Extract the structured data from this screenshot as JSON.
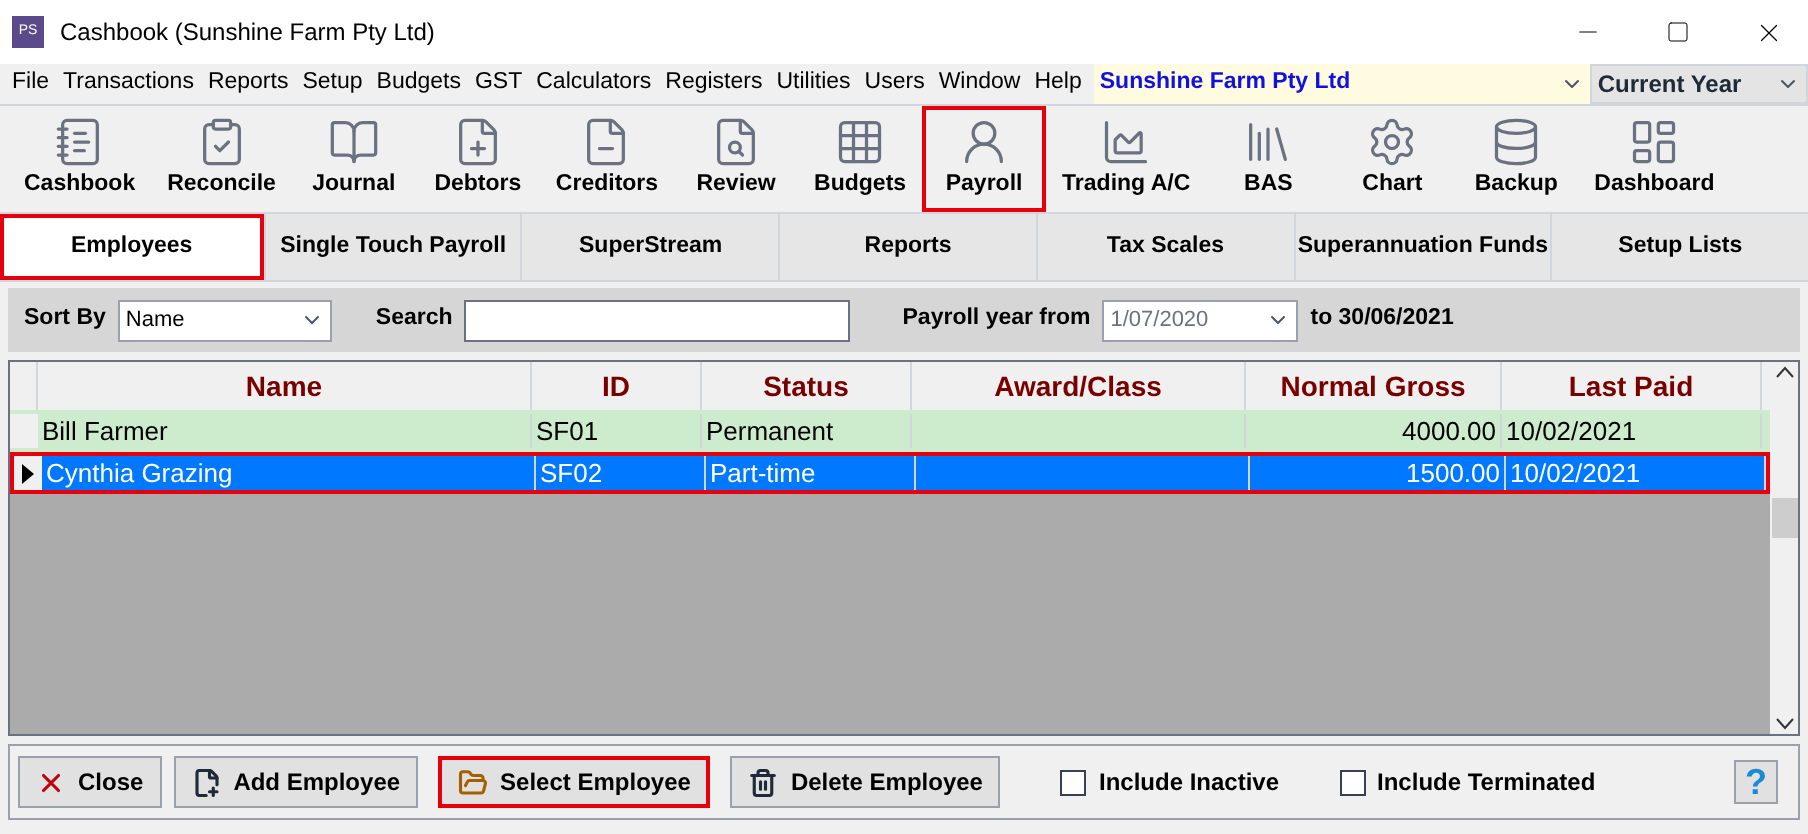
{
  "window": {
    "title": "Cashbook (Sunshine Farm Pty Ltd)",
    "app_icon": "PS"
  },
  "menu": [
    "File",
    "Transactions",
    "Reports",
    "Setup",
    "Budgets",
    "GST",
    "Calculators",
    "Registers",
    "Utilities",
    "Users",
    "Window",
    "Help"
  ],
  "company": {
    "value": "Sunshine Farm Pty Ltd"
  },
  "year": {
    "value": "Current Year"
  },
  "toolbar": [
    {
      "label": "Cashbook",
      "kind": "notepad",
      "highlighted": false
    },
    {
      "label": "Reconcile",
      "kind": "tick",
      "highlighted": false
    },
    {
      "label": "Journal",
      "kind": "book",
      "highlighted": false
    },
    {
      "label": "Debtors",
      "kind": "plus",
      "highlighted": false
    },
    {
      "label": "Creditors",
      "kind": "minus",
      "highlighted": false
    },
    {
      "label": "Review",
      "kind": "magnifier",
      "highlighted": false
    },
    {
      "label": "Budgets",
      "kind": "grid",
      "highlighted": false
    },
    {
      "label": "Payroll",
      "kind": "person",
      "highlighted": true
    },
    {
      "label": "Trading A/C",
      "kind": "chart",
      "highlighted": false
    },
    {
      "label": "BAS",
      "kind": "binders",
      "highlighted": false
    },
    {
      "label": "Chart",
      "kind": "gear",
      "highlighted": false
    },
    {
      "label": "Backup",
      "kind": "database",
      "highlighted": false
    },
    {
      "label": "Dashboard",
      "kind": "dashboard",
      "highlighted": false
    }
  ],
  "tabs": [
    {
      "label": "Employees",
      "selected": true,
      "highlighted": true
    },
    {
      "label": "Single Touch Payroll",
      "selected": false,
      "highlighted": false
    },
    {
      "label": "SuperStream",
      "selected": false,
      "highlighted": false
    },
    {
      "label": "Reports",
      "selected": false,
      "highlighted": false
    },
    {
      "label": "Tax Scales",
      "selected": false,
      "highlighted": false
    },
    {
      "label": "Superannuation Funds",
      "selected": false,
      "highlighted": false
    },
    {
      "label": "Setup Lists",
      "selected": false,
      "highlighted": false
    }
  ],
  "filter": {
    "sort_label": "Sort By",
    "sort_value": "Name",
    "search_label": "Search",
    "year_label": "Payroll year from",
    "year_from": "1/07/2020",
    "year_to": "to 30/06/2021"
  },
  "table": {
    "columns": [
      "Name",
      "ID",
      "Status",
      "Award/Class",
      "Normal Gross",
      "Last Paid"
    ],
    "rows": [
      {
        "cells": [
          "Bill Farmer",
          "SF01",
          "Permanent",
          "",
          "4000.00",
          "10/02/2021"
        ],
        "selected": false,
        "highlighted": false
      },
      {
        "cells": [
          "Cynthia Grazing",
          "SF02",
          "Part-time",
          "",
          "1500.00",
          "10/02/2021"
        ],
        "selected": true,
        "highlighted": true
      }
    ]
  },
  "buttons": [
    {
      "label": "Close",
      "kind": "close",
      "highlighted": false
    },
    {
      "label": "Add Employee",
      "kind": "add",
      "highlighted": false
    },
    {
      "label": "Select Employee",
      "kind": "select",
      "highlighted": true
    },
    {
      "label": "Delete Employee",
      "kind": "delete",
      "highlighted": false
    }
  ],
  "checkboxes": [
    {
      "label": "Include Inactive",
      "checked": false
    },
    {
      "label": "Include Terminated",
      "checked": false
    }
  ],
  "help": "?"
}
